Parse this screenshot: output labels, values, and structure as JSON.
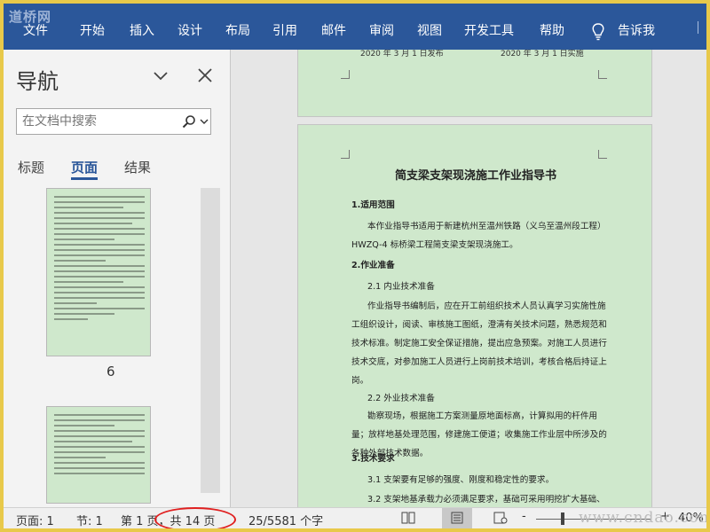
{
  "watermark_top": "道桥网",
  "ribbon": {
    "tabs": [
      "文件",
      "开始",
      "插入",
      "设计",
      "布局",
      "引用",
      "邮件",
      "审阅",
      "视图",
      "开发工具",
      "帮助"
    ],
    "tell_me": "告诉我"
  },
  "nav": {
    "title": "导航",
    "search_placeholder": "在文档中搜索",
    "tabs": [
      "标题",
      "页面",
      "结果"
    ],
    "active_tab": "页面",
    "thumb_page_number": "6"
  },
  "document": {
    "prev_page_dates": [
      "2020 年 3 月 1 日发布",
      "2020 年 3 月 1 日实施"
    ],
    "title": "简支梁支架现浇施工作业指导书",
    "paragraphs": [
      {
        "text": "1.适用范围",
        "bold": true
      },
      {
        "text": "本作业指导书适用于新建杭州至温州铁路（义乌至温州段工程）HWZQ-4 标桥梁工程简支梁支架现浇施工。",
        "bold": false
      },
      {
        "text": "2.作业准备",
        "bold": true
      },
      {
        "text": "2.1 内业技术准备",
        "bold": false
      },
      {
        "text": "作业指导书编制后，应在开工前组织技术人员认真学习实施性施工组织设计，阅读、审核施工图纸，澄清有关技术问题，熟悉规范和技术标准。制定施工安全保证措施，提出应急预案。对施工人员进行技术交底，对参加施工人员进行上岗前技术培训，考核合格后持证上岗。",
        "bold": false
      },
      {
        "text": "2.2 外业技术准备",
        "bold": false
      },
      {
        "text": "勘察现场，根据施工方案测量原地面标高，计算拟用的杆件用量；放样地基处理范围，修建施工便道；收集施工作业层中所涉及的各种外部技术数据。",
        "bold": false
      },
      {
        "text": "3.技术要求",
        "bold": true
      },
      {
        "text": "3.1 支架要有足够的强度、刚度和稳定性的要求。",
        "bold": false
      },
      {
        "text": "3.2 支架地基承载力必须满足要求，基础可采用明挖扩大基础、",
        "bold": false
      }
    ]
  },
  "status": {
    "page": "页面: 1",
    "section": "节: 1",
    "page_of": "第 1 页，共 14 页",
    "words": "25/5581 个字",
    "zoom": "40%",
    "zoom_minus": "-",
    "zoom_plus": "+"
  },
  "watermark_bottom": "www.cndao.com",
  "colors": {
    "ribbon": "#2b579a",
    "page_bg": "#cfe8cc",
    "highlight_oval": "#e02020"
  }
}
